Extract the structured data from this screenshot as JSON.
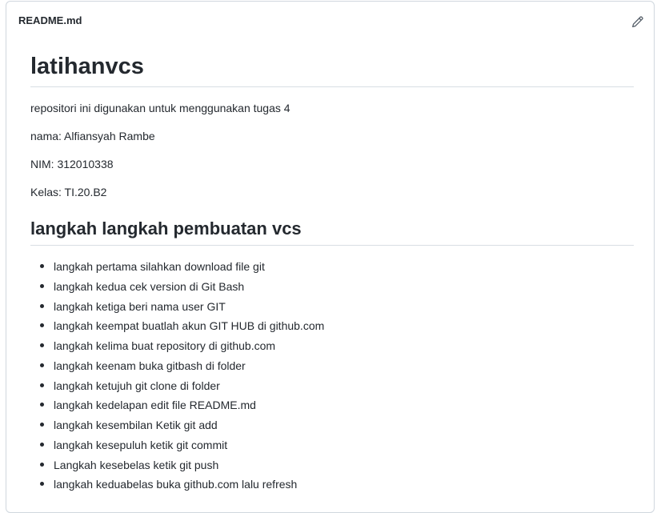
{
  "header": {
    "file_name": "README.md",
    "edit_icon": "pencil-icon"
  },
  "readme": {
    "title": "latihanvcs",
    "paragraphs": [
      "repositori ini digunakan untuk menggunakan tugas 4",
      "nama: Alfiansyah Rambe",
      "NIM: 312010338",
      "Kelas: TI.20.B2"
    ],
    "section_title": "langkah langkah pembuatan vcs",
    "steps": [
      "langkah pertama silahkan download file git",
      "langkah kedua cek version di Git Bash",
      "langkah ketiga beri nama user GIT",
      "langkah keempat buatlah akun GIT HUB di github.com",
      "langkah kelima buat repository di github.com",
      "langkah keenam buka gitbash di folder",
      "langkah ketujuh git clone di folder",
      "langkah kedelapan edit file README.md",
      "langkah kesembilan Ketik git add",
      "langkah kesepuluh ketik git commit",
      "Langkah kesebelas ketik git push",
      "langkah keduabelas buka github.com lalu refresh"
    ]
  },
  "colors": {
    "text": "#24292f",
    "border": "#d0d7de",
    "divider": "#d8dee4",
    "icon": "#57606a"
  }
}
